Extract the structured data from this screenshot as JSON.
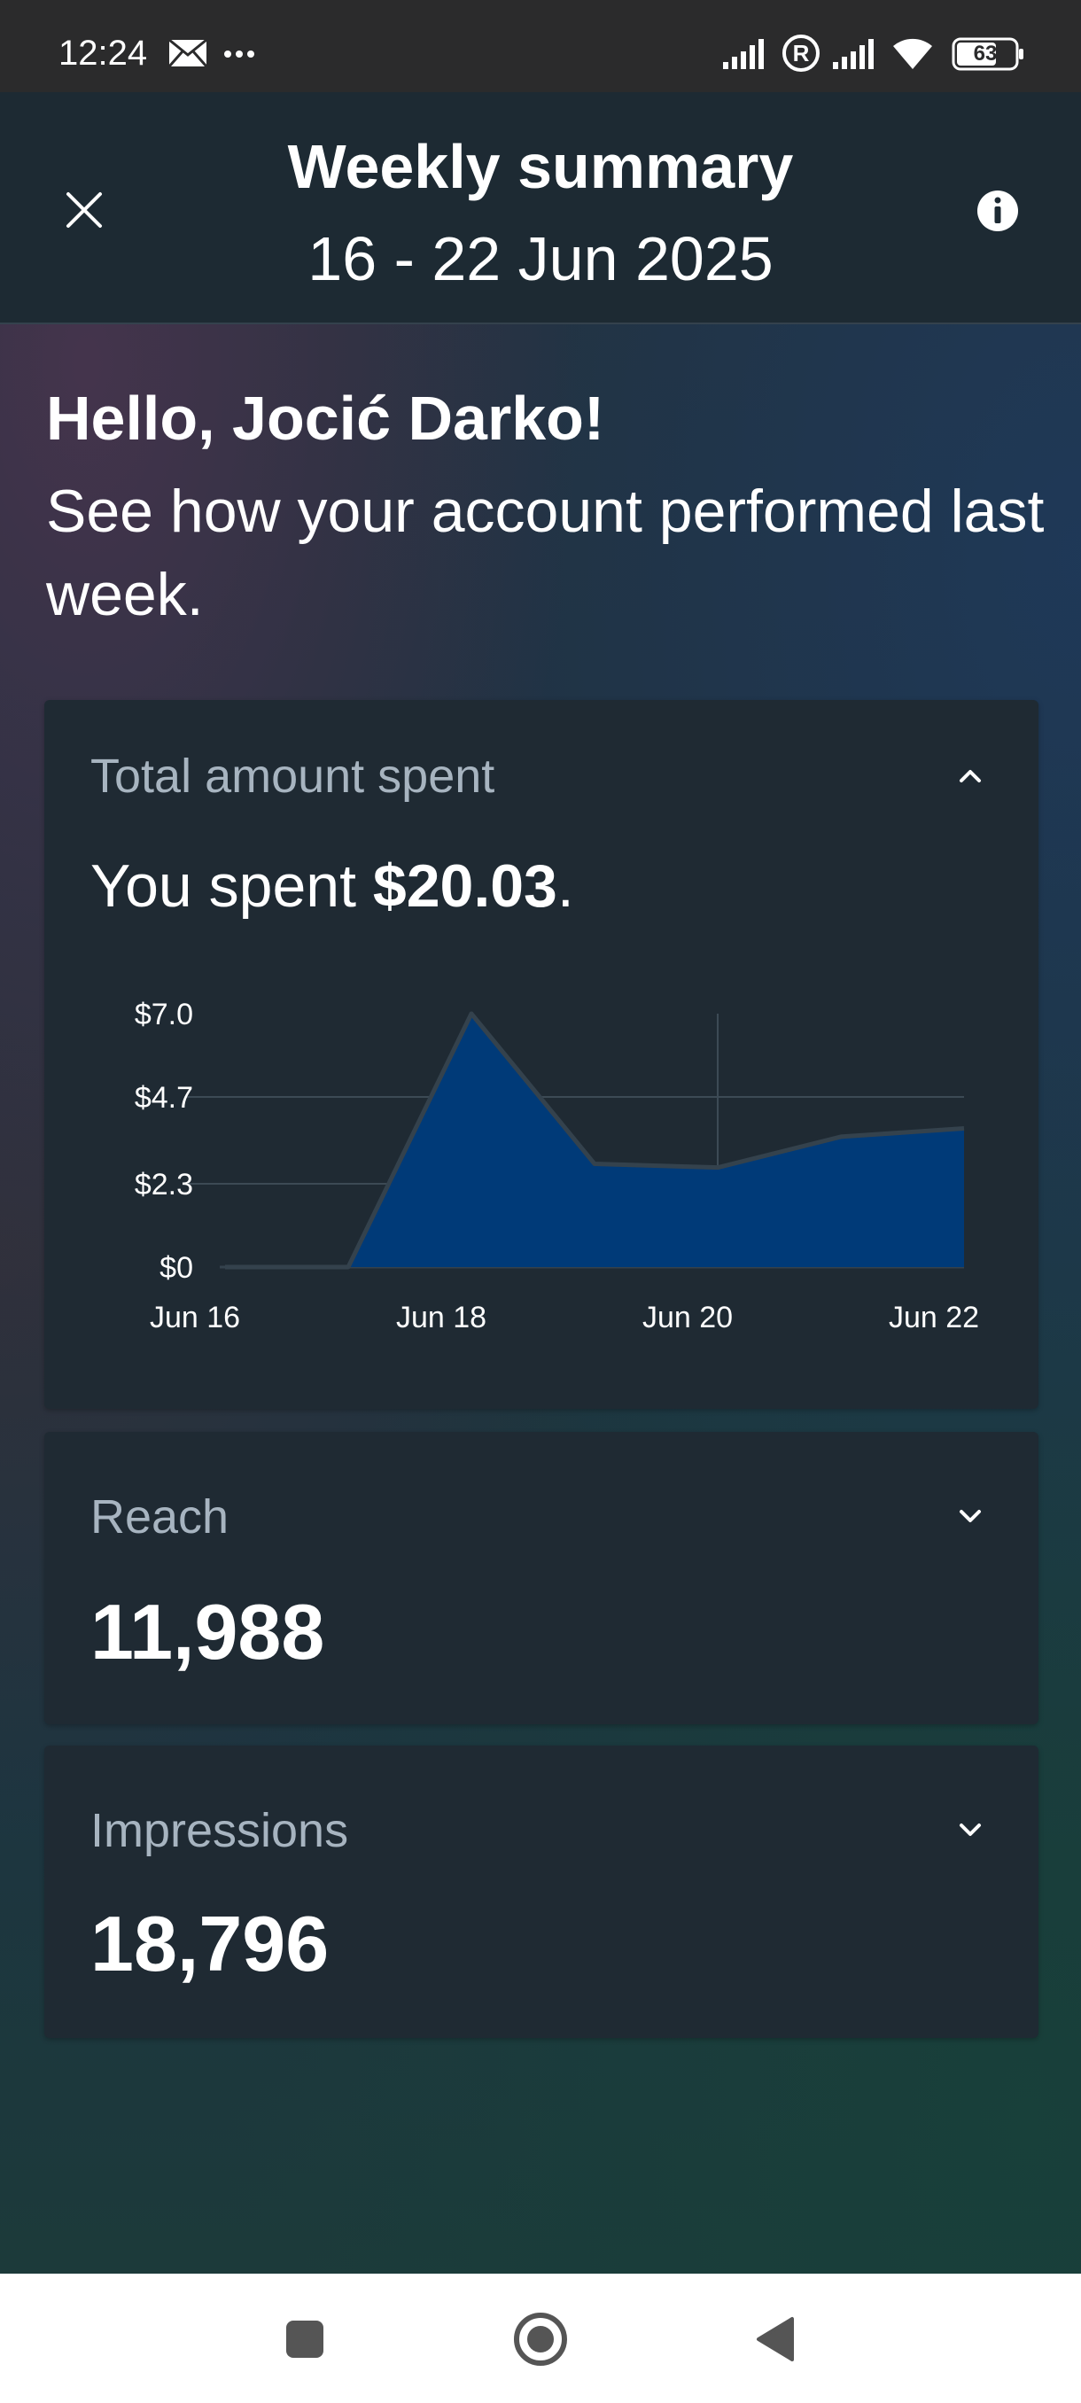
{
  "status_bar": {
    "time": "12:24",
    "icons": [
      "mail-icon",
      "more-dots-icon",
      "signal-icon",
      "registered-icon",
      "signal-icon",
      "wifi-icon",
      "battery-icon"
    ],
    "battery_level": "63"
  },
  "header": {
    "title": "Weekly summary",
    "date_range": "16 - 22 Jun 2025",
    "close_icon": "close-icon",
    "info_icon": "info-icon"
  },
  "greeting": {
    "headline": "Hello, Jocić Darko!",
    "message": "See how your account performed last week."
  },
  "cards": {
    "spent": {
      "label": "Total amount spent",
      "sentence_prefix": "You spent ",
      "amount": "$20.03",
      "sentence_suffix": ".",
      "expanded": true
    },
    "reach": {
      "label": "Reach",
      "value": "11,988",
      "expanded": false
    },
    "impressions": {
      "label": "Impressions",
      "value": "18,796",
      "expanded": false
    }
  },
  "chart_data": {
    "type": "area",
    "title": "",
    "xlabel": "",
    "ylabel": "",
    "x": [
      "Jun 16",
      "Jun 17",
      "Jun 18",
      "Jun 19",
      "Jun 20",
      "Jun 21",
      "Jun 22"
    ],
    "x_tick_labels": [
      "Jun 16",
      "Jun 18",
      "Jun 20",
      "Jun 22"
    ],
    "series": [
      {
        "values": [
          0,
          0,
          7.0,
          2.85,
          2.75,
          3.6,
          3.83
        ]
      }
    ],
    "y_ticks": [
      "$0",
      "$2.3",
      "$4.7",
      "$7.0"
    ],
    "y_tick_values": [
      0,
      2.3,
      4.7,
      7.0
    ],
    "ylim": [
      0,
      7.0
    ],
    "grid": true,
    "fill_color": "#003a78",
    "line_color": "#34424d",
    "marker_label": "Jun 20"
  },
  "nav_bar": {
    "buttons": [
      "recents-square-icon",
      "home-circle-icon",
      "back-triangle-icon"
    ]
  },
  "colors": {
    "card_bg": "#1f2a33",
    "label": "#a7b4c0",
    "header_bg": "#1d2a33",
    "status_bg": "#2b2b2c"
  }
}
